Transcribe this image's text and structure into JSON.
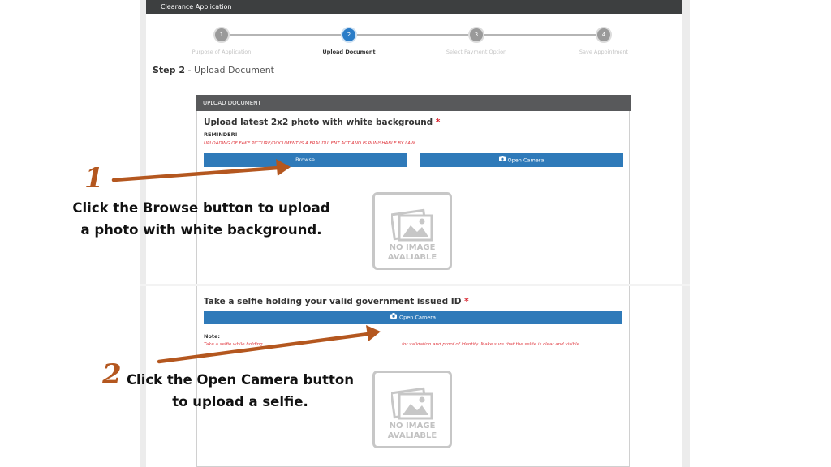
{
  "window": {
    "title": "Clearance Application"
  },
  "stepper": {
    "steps": [
      {
        "number": "1",
        "label": "Purpose of Application",
        "active": false
      },
      {
        "number": "2",
        "label": "Upload Document",
        "active": true
      },
      {
        "number": "3",
        "label": "Select Payment Option",
        "active": false
      },
      {
        "number": "4",
        "label": "Save Appointment",
        "active": false
      }
    ]
  },
  "page": {
    "step_prefix": "Step 2",
    "step_title": " - Upload Document"
  },
  "panel": {
    "header": "UPLOAD DOCUMENT"
  },
  "photo_section": {
    "title": "Upload latest 2x2 photo with white background",
    "required_mark": "*",
    "reminder_label": "REMINDER!",
    "warning": "UPLOADING OF FAKE PICTURE/DOCUMENT IS A FRAUDULENT ACT AND IS PUNISHABLE BY LAW.",
    "browse_label": "Browse",
    "camera_label": "Open Camera",
    "placeholder_line1": "NO IMAGE",
    "placeholder_line2": "AVALIABLE"
  },
  "selfie_section": {
    "title": "Take a selfie holding your valid government issued ID",
    "required_mark": "*",
    "camera_label": "Open Camera",
    "note_label": "Note:",
    "note_text_start": "Take a selfie while holding",
    "note_text_end": "for validation and proof of identity. Make sure that the selfie is clear and visible.",
    "placeholder_line1": "NO IMAGE",
    "placeholder_line2": "AVALIABLE"
  },
  "annotations": {
    "one": {
      "number": "1",
      "line1": "Click the Browse button to upload",
      "line2": "a photo with white background."
    },
    "two": {
      "number": "2",
      "line1": "Click the Open Camera button",
      "line2": "to upload  a selfie."
    }
  },
  "colors": {
    "accent": "#2f7ab9",
    "arrow": "#b4571f",
    "warning": "#e0383f",
    "titlebar": "#3d3f40"
  }
}
